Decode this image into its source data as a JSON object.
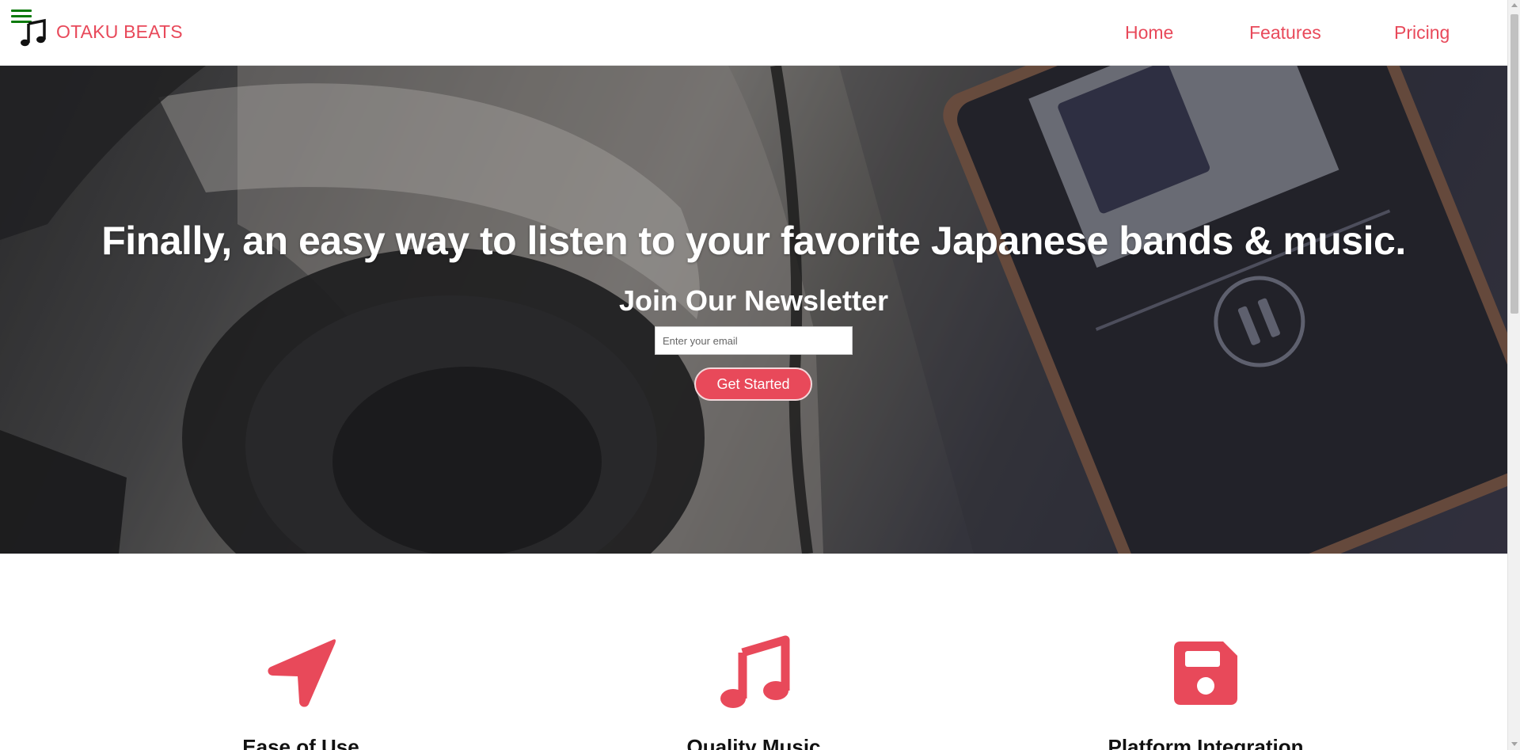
{
  "header": {
    "brand": "OTAKU BEATS",
    "nav": [
      {
        "label": "Home"
      },
      {
        "label": "Features"
      },
      {
        "label": "Pricing"
      }
    ]
  },
  "hero": {
    "title": "Finally, an easy way to listen to your favorite Japanese bands & music.",
    "newsletter_title": "Join Our Newsletter",
    "email_placeholder": "Enter your email",
    "cta_label": "Get Started"
  },
  "features": [
    {
      "title": "Ease of Use",
      "icon": "location-arrow-icon"
    },
    {
      "title": "Quality Music",
      "icon": "music-icon"
    },
    {
      "title": "Platform Integration",
      "icon": "save-icon"
    }
  ],
  "colors": {
    "accent": "#e8495a",
    "menu_icon": "#0a7a0a"
  }
}
